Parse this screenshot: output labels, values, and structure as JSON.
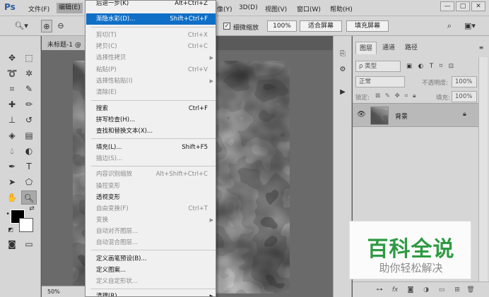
{
  "menubar": {
    "logo": "Ps",
    "items": [
      {
        "label": "文件(F)"
      },
      {
        "label": "编辑(E)"
      },
      {
        "label": "像(Y)"
      },
      {
        "label": "3D(D)"
      },
      {
        "label": "视图(V)"
      },
      {
        "label": "窗口(W)"
      },
      {
        "label": "帮助(H)"
      }
    ],
    "window_controls": [
      "—",
      "□",
      "✕"
    ]
  },
  "options_bar": {
    "checkbox_checked": true,
    "checkbox_label": "细微缩放",
    "zoom_value": "100%",
    "fit_screen_label": "适合屏幕",
    "fill_screen_label": "填充屏幕"
  },
  "document": {
    "tab_label": "未标题-1 @",
    "zoom_status": "50%"
  },
  "edit_menu": {
    "items": [
      {
        "label": "后退一步(K)",
        "shortcut": "Alt+Ctrl+Z",
        "enabled": true
      },
      {
        "label": "渐隐水彩(D)...",
        "shortcut": "Shift+Ctrl+F",
        "enabled": true,
        "highlighted": true
      },
      {
        "label": "剪切(T)",
        "shortcut": "Ctrl+X",
        "enabled": false
      },
      {
        "label": "拷贝(C)",
        "shortcut": "Ctrl+C",
        "enabled": false
      },
      {
        "label": "选择性拷贝",
        "shortcut": "",
        "enabled": false,
        "submenu": true
      },
      {
        "label": "粘贴(P)",
        "shortcut": "Ctrl+V",
        "enabled": false
      },
      {
        "label": "选择性粘贴(I)",
        "shortcut": "",
        "enabled": false,
        "submenu": true
      },
      {
        "label": "清除(E)",
        "shortcut": "",
        "enabled": false
      },
      {
        "label": "搜索",
        "shortcut": "Ctrl+F",
        "enabled": true
      },
      {
        "label": "拼写检查(H)...",
        "shortcut": "",
        "enabled": true
      },
      {
        "label": "查找和替换文本(X)...",
        "shortcut": "",
        "enabled": true
      },
      {
        "label": "填充(L)...",
        "shortcut": "Shift+F5",
        "enabled": true
      },
      {
        "label": "描边(S)...",
        "shortcut": "",
        "enabled": false
      },
      {
        "label": "内容识别缩放",
        "shortcut": "Alt+Shift+Ctrl+C",
        "enabled": false
      },
      {
        "label": "操控变形",
        "shortcut": "",
        "enabled": false
      },
      {
        "label": "透视变形",
        "shortcut": "",
        "enabled": true
      },
      {
        "label": "自由变换(F)",
        "shortcut": "Ctrl+T",
        "enabled": false
      },
      {
        "label": "变换",
        "shortcut": "",
        "enabled": false,
        "submenu": true
      },
      {
        "label": "自动对齐图层...",
        "shortcut": "",
        "enabled": false
      },
      {
        "label": "自动混合图层...",
        "shortcut": "",
        "enabled": false
      },
      {
        "label": "定义画笔预设(B)...",
        "shortcut": "",
        "enabled": true
      },
      {
        "label": "定义图案...",
        "shortcut": "",
        "enabled": true
      },
      {
        "label": "定义自定形状...",
        "shortcut": "",
        "enabled": false
      },
      {
        "label": "清理(R)",
        "shortcut": "",
        "enabled": true,
        "submenu": true
      }
    ]
  },
  "layers_panel": {
    "tabs": [
      {
        "label": "图层",
        "active": true
      },
      {
        "label": "通道",
        "active": false
      },
      {
        "label": "路径",
        "active": false
      }
    ],
    "filter_label": "ρ 类型",
    "blend_mode": "正常",
    "opacity_label": "不透明度:",
    "opacity_value": "100%",
    "lock_label": "锁定:",
    "fill_label": "填充:",
    "fill_value": "100%",
    "layer_name": "背景"
  },
  "watermark": {
    "title": "百科全说",
    "subtitle": "助你轻松解决"
  },
  "colors": {
    "menu_highlight": "#0f6fc6",
    "watermark_green": "#2e9a43",
    "foreground": "#000000",
    "background": "#ffffff"
  }
}
